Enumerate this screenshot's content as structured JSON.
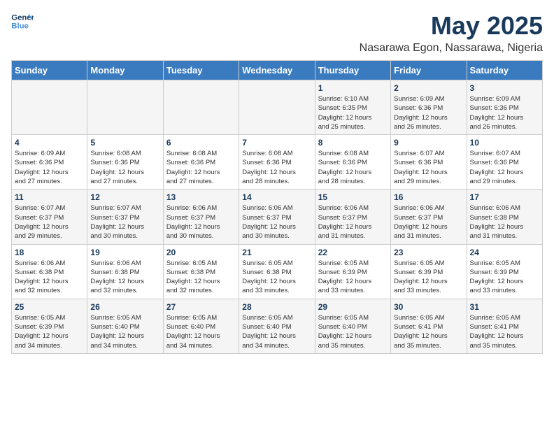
{
  "header": {
    "logo_line1": "General",
    "logo_line2": "Blue",
    "title": "May 2025",
    "subtitle": "Nasarawa Egon, Nassarawa, Nigeria"
  },
  "weekdays": [
    "Sunday",
    "Monday",
    "Tuesday",
    "Wednesday",
    "Thursday",
    "Friday",
    "Saturday"
  ],
  "weeks": [
    [
      {
        "day": "",
        "info": ""
      },
      {
        "day": "",
        "info": ""
      },
      {
        "day": "",
        "info": ""
      },
      {
        "day": "",
        "info": ""
      },
      {
        "day": "1",
        "info": "Sunrise: 6:10 AM\nSunset: 6:35 PM\nDaylight: 12 hours\nand 25 minutes."
      },
      {
        "day": "2",
        "info": "Sunrise: 6:09 AM\nSunset: 6:36 PM\nDaylight: 12 hours\nand 26 minutes."
      },
      {
        "day": "3",
        "info": "Sunrise: 6:09 AM\nSunset: 6:36 PM\nDaylight: 12 hours\nand 26 minutes."
      }
    ],
    [
      {
        "day": "4",
        "info": "Sunrise: 6:09 AM\nSunset: 6:36 PM\nDaylight: 12 hours\nand 27 minutes."
      },
      {
        "day": "5",
        "info": "Sunrise: 6:08 AM\nSunset: 6:36 PM\nDaylight: 12 hours\nand 27 minutes."
      },
      {
        "day": "6",
        "info": "Sunrise: 6:08 AM\nSunset: 6:36 PM\nDaylight: 12 hours\nand 27 minutes."
      },
      {
        "day": "7",
        "info": "Sunrise: 6:08 AM\nSunset: 6:36 PM\nDaylight: 12 hours\nand 28 minutes."
      },
      {
        "day": "8",
        "info": "Sunrise: 6:08 AM\nSunset: 6:36 PM\nDaylight: 12 hours\nand 28 minutes."
      },
      {
        "day": "9",
        "info": "Sunrise: 6:07 AM\nSunset: 6:36 PM\nDaylight: 12 hours\nand 29 minutes."
      },
      {
        "day": "10",
        "info": "Sunrise: 6:07 AM\nSunset: 6:36 PM\nDaylight: 12 hours\nand 29 minutes."
      }
    ],
    [
      {
        "day": "11",
        "info": "Sunrise: 6:07 AM\nSunset: 6:37 PM\nDaylight: 12 hours\nand 29 minutes."
      },
      {
        "day": "12",
        "info": "Sunrise: 6:07 AM\nSunset: 6:37 PM\nDaylight: 12 hours\nand 30 minutes."
      },
      {
        "day": "13",
        "info": "Sunrise: 6:06 AM\nSunset: 6:37 PM\nDaylight: 12 hours\nand 30 minutes."
      },
      {
        "day": "14",
        "info": "Sunrise: 6:06 AM\nSunset: 6:37 PM\nDaylight: 12 hours\nand 30 minutes."
      },
      {
        "day": "15",
        "info": "Sunrise: 6:06 AM\nSunset: 6:37 PM\nDaylight: 12 hours\nand 31 minutes."
      },
      {
        "day": "16",
        "info": "Sunrise: 6:06 AM\nSunset: 6:37 PM\nDaylight: 12 hours\nand 31 minutes."
      },
      {
        "day": "17",
        "info": "Sunrise: 6:06 AM\nSunset: 6:38 PM\nDaylight: 12 hours\nand 31 minutes."
      }
    ],
    [
      {
        "day": "18",
        "info": "Sunrise: 6:06 AM\nSunset: 6:38 PM\nDaylight: 12 hours\nand 32 minutes."
      },
      {
        "day": "19",
        "info": "Sunrise: 6:06 AM\nSunset: 6:38 PM\nDaylight: 12 hours\nand 32 minutes."
      },
      {
        "day": "20",
        "info": "Sunrise: 6:05 AM\nSunset: 6:38 PM\nDaylight: 12 hours\nand 32 minutes."
      },
      {
        "day": "21",
        "info": "Sunrise: 6:05 AM\nSunset: 6:38 PM\nDaylight: 12 hours\nand 33 minutes."
      },
      {
        "day": "22",
        "info": "Sunrise: 6:05 AM\nSunset: 6:39 PM\nDaylight: 12 hours\nand 33 minutes."
      },
      {
        "day": "23",
        "info": "Sunrise: 6:05 AM\nSunset: 6:39 PM\nDaylight: 12 hours\nand 33 minutes."
      },
      {
        "day": "24",
        "info": "Sunrise: 6:05 AM\nSunset: 6:39 PM\nDaylight: 12 hours\nand 33 minutes."
      }
    ],
    [
      {
        "day": "25",
        "info": "Sunrise: 6:05 AM\nSunset: 6:39 PM\nDaylight: 12 hours\nand 34 minutes."
      },
      {
        "day": "26",
        "info": "Sunrise: 6:05 AM\nSunset: 6:40 PM\nDaylight: 12 hours\nand 34 minutes."
      },
      {
        "day": "27",
        "info": "Sunrise: 6:05 AM\nSunset: 6:40 PM\nDaylight: 12 hours\nand 34 minutes."
      },
      {
        "day": "28",
        "info": "Sunrise: 6:05 AM\nSunset: 6:40 PM\nDaylight: 12 hours\nand 34 minutes."
      },
      {
        "day": "29",
        "info": "Sunrise: 6:05 AM\nSunset: 6:40 PM\nDaylight: 12 hours\nand 35 minutes."
      },
      {
        "day": "30",
        "info": "Sunrise: 6:05 AM\nSunset: 6:41 PM\nDaylight: 12 hours\nand 35 minutes."
      },
      {
        "day": "31",
        "info": "Sunrise: 6:05 AM\nSunset: 6:41 PM\nDaylight: 12 hours\nand 35 minutes."
      }
    ]
  ]
}
